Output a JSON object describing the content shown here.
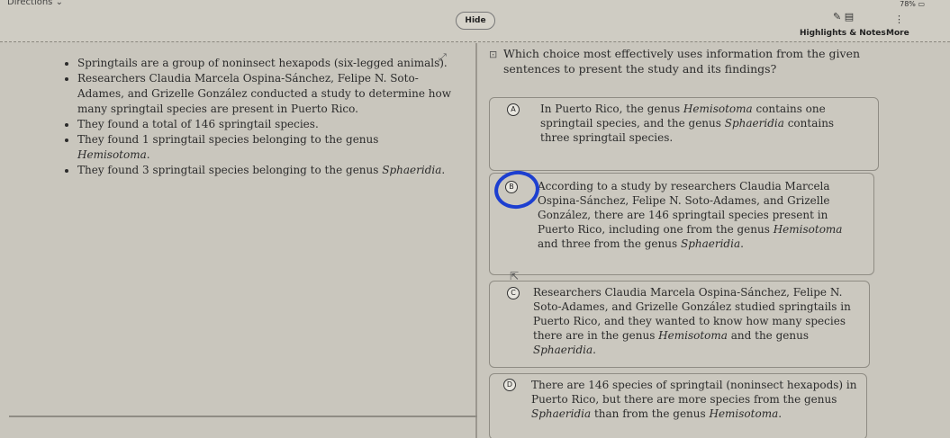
{
  "topbar": {
    "directions_label": "Directions",
    "battery": "78%",
    "hide_label": "Hide",
    "highlights_label": "Highlights & Notes",
    "more_label": "More"
  },
  "passage": {
    "bullets": [
      "Springtails are a group of noninsect hexapods (six-legged animals).",
      "Researchers Claudia Marcela Ospina-Sánchez, Felipe N. Soto-Adames, and Grizelle González conducted a study to determine how many springtail species are present in Puerto Rico.",
      "They found a total of 146 springtail species.",
      "They found 1 springtail species belonging to the genus Hemisotoma.",
      "They found 3 springtail species belonging to the genus Sphaeridia."
    ]
  },
  "question": {
    "prompt": "Which choice most effectively uses information from the given sentences to present the study and its findings?"
  },
  "choices": [
    {
      "letter": "A",
      "text": "In Puerto Rico, the genus Hemisotoma contains one springtail species, and the genus Sphaeridia contains three springtail species."
    },
    {
      "letter": "B",
      "text": "According to a study by researchers Claudia Marcela Ospina-Sánchez, Felipe N. Soto-Adames, and Grizelle González, there are 146 springtail species present in Puerto Rico, including one from the genus Hemisotoma and three from the genus Sphaeridia."
    },
    {
      "letter": "C",
      "text": "Researchers Claudia Marcela Ospina-Sánchez, Felipe N. Soto-Adames, and Grizelle González studied springtails in Puerto Rico, and they wanted to know how many species there are in the genus Hemisotoma and the genus Sphaeridia."
    },
    {
      "letter": "D",
      "text": "There are 146 species of springtail (noninsect hexapods) in Puerto Rico, but there are more species from the genus Sphaeridia than from the genus Hemisotoma."
    }
  ]
}
